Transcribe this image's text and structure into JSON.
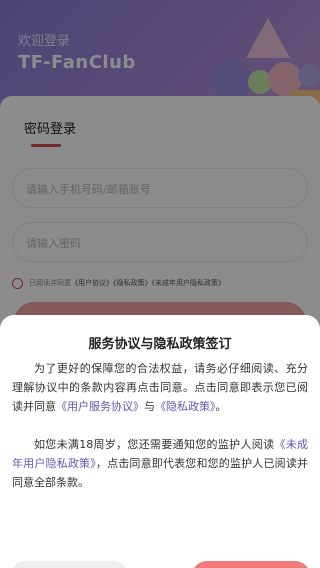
{
  "header": {
    "welcome": "欢迎登录",
    "app_name": "TF-FanClub"
  },
  "login": {
    "tab_label": "密码登录",
    "account_placeholder": "请输入手机号码/邮箱账号",
    "password_placeholder": "请输入密码",
    "agree_prefix": "已阅读并同意",
    "agree_link_user": "《用户协议》",
    "agree_link_privacy": "《隐私政策》",
    "agree_link_minor": "《未成年用户隐私政策》"
  },
  "dialog": {
    "title": "服务协议与隐私政策签订",
    "para1_text": "为了更好的保障您的合法权益，请务必仔细阅读、充分理解协议中的条款内容再点击同意。点击同意即表示您已阅读并同意",
    "para1_link1": "《用户服务协议》",
    "para1_mid": "与",
    "para1_link2": "《隐私政策》",
    "para1_end": "。",
    "para2_text": "如您未满18周岁，您还需要通知您的监护人阅读",
    "para2_link": "《未成年用户隐私政策》",
    "para2_end": "，点击同意即代表您和您的监护人已阅读并同意全部条款。"
  },
  "colors": {
    "accent": "#d94b5a",
    "link": "#6655b8",
    "header_start": "#8b7fd6",
    "header_end": "#c79bd3"
  }
}
